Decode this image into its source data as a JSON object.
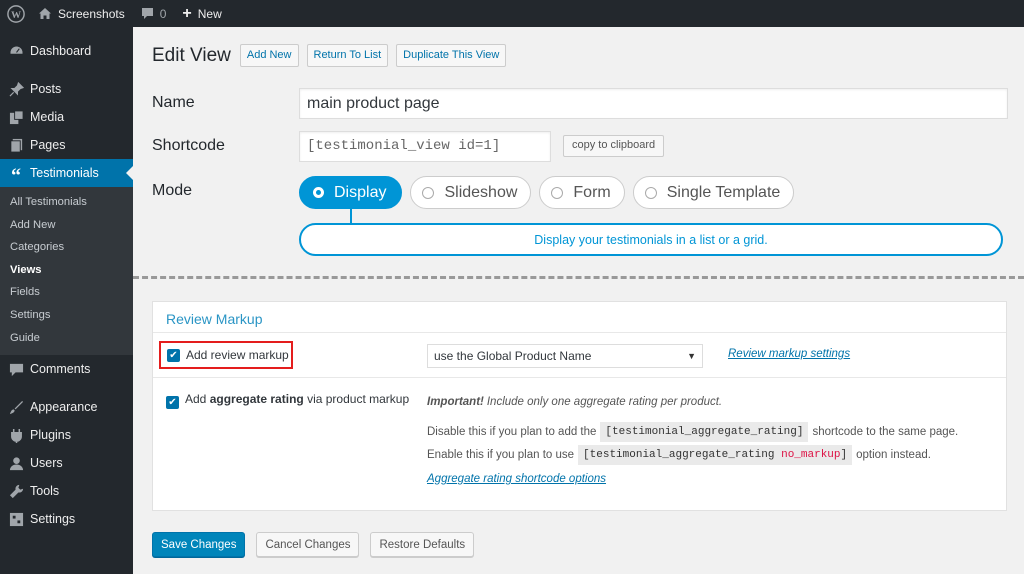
{
  "adminbar": {
    "site_name": "Screenshots",
    "comments_count": "0",
    "new_label": "New"
  },
  "sidebar": {
    "items_top": [
      {
        "label": "Dashboard",
        "icon": "dashboard-icon"
      }
    ],
    "items_mid": [
      {
        "label": "Posts",
        "icon": "pin-icon"
      },
      {
        "label": "Media",
        "icon": "media-icon"
      },
      {
        "label": "Pages",
        "icon": "pages-icon"
      }
    ],
    "current": {
      "label": "Testimonials",
      "icon": "quote-icon"
    },
    "submenu": [
      "All Testimonials",
      "Add New",
      "Categories",
      "Views",
      "Fields",
      "Settings",
      "Guide"
    ],
    "submenu_current": "Views",
    "items_bottom": [
      {
        "label": "Comments",
        "icon": "comment-icon"
      },
      {
        "label": "Appearance",
        "icon": "brush-icon"
      },
      {
        "label": "Plugins",
        "icon": "plugin-icon"
      },
      {
        "label": "Users",
        "icon": "user-icon"
      },
      {
        "label": "Tools",
        "icon": "wrench-icon"
      },
      {
        "label": "Settings",
        "icon": "settings-icon"
      }
    ]
  },
  "header": {
    "title": "Edit View",
    "actions": [
      "Add New",
      "Return To List",
      "Duplicate This View"
    ]
  },
  "form": {
    "name_label": "Name",
    "name_value": "main product page",
    "shortcode_label": "Shortcode",
    "shortcode_value": "[testimonial_view id=1]",
    "copy_label": "copy to clipboard",
    "mode_label": "Mode",
    "modes": [
      {
        "label": "Display",
        "selected": true
      },
      {
        "label": "Slideshow",
        "selected": false
      },
      {
        "label": "Form",
        "selected": false
      },
      {
        "label": "Single Template",
        "selected": false
      }
    ],
    "mode_description": "Display your testimonials in a list or a grid."
  },
  "review": {
    "title": "Review Markup",
    "add_review_label": "Add review markup",
    "add_review_checked": true,
    "product_select": "use the Global Product Name",
    "settings_link": "Review markup settings",
    "agg_prefix": "Add",
    "agg_bold": "aggregate rating",
    "agg_suffix": "via product markup",
    "agg_checked": true,
    "important_label": "Important!",
    "important_text": "Include only one aggregate rating per product.",
    "disable_pre": "Disable this if you plan to add the",
    "disable_code": "[testimonial_aggregate_rating]",
    "disable_post": "shortcode to the same page.",
    "enable_pre": "Enable this if you plan to use",
    "enable_code": "[testimonial_aggregate_rating",
    "enable_code_red": "no_markup",
    "enable_code_end": "]",
    "enable_post": "option instead.",
    "options_link": "Aggregate rating shortcode options"
  },
  "footer": {
    "save": "Save Changes",
    "cancel": "Cancel Changes",
    "restore": "Restore Defaults"
  },
  "colors": {
    "accent": "#0073aa",
    "mode_blue": "#0095d6",
    "highlight": "#e41d1d"
  }
}
